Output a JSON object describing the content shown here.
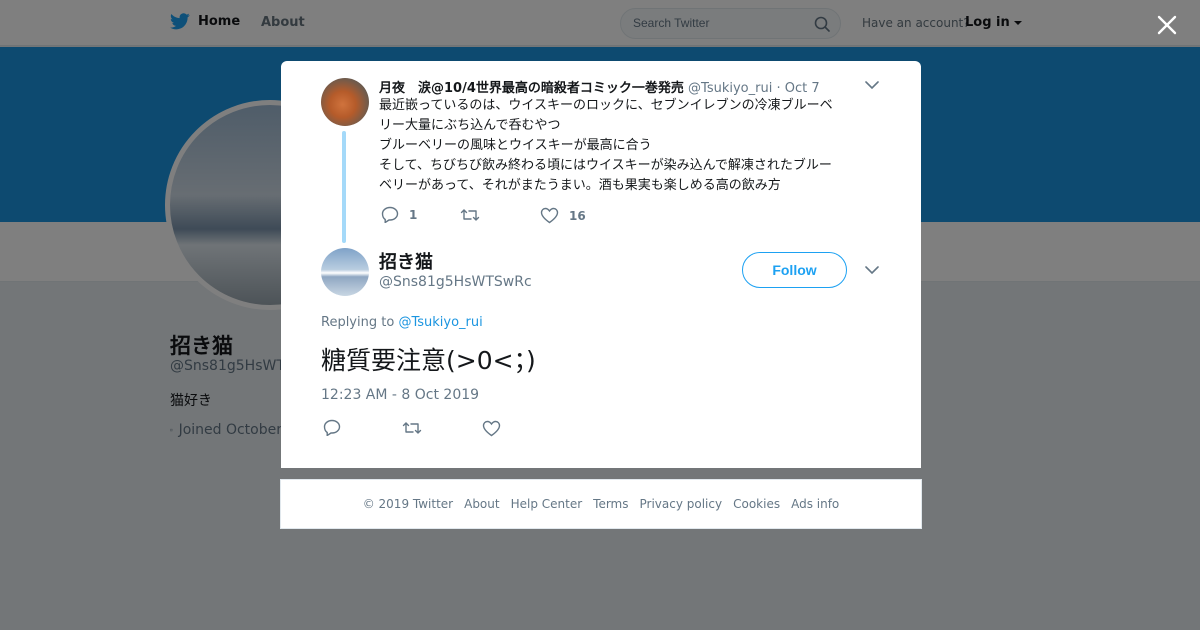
{
  "topbar": {
    "home_label": "Home",
    "about_label": "About",
    "search_placeholder": "Search Twitter",
    "have_account": "Have an account?",
    "login_label": "Log in"
  },
  "profile": {
    "name": "招き猫",
    "handle": "@Sns81g5HsWTSwRc",
    "bio": "猫好き",
    "joined": "Joined October"
  },
  "parent_tweet": {
    "name": "月夜　涙@10/4世界最高の暗殺者コミック一巻発売",
    "handle": "@Tsukiyo_rui",
    "separator": "·",
    "date": "Oct 7",
    "lines": [
      "最近嵌っているのは、ウイスキーのロックに、セブンイレブンの冷凍ブルーベ",
      "リー大量にぶち込んで呑むやつ",
      "ブルーベリーの風味とウイスキーが最高に合う",
      "そして、ちびちび飲み終わる頃にはウイスキーが染み込んで解凍されたブルー",
      "ベリーがあって、それがまたうまい。酒も果実も楽しめる高の飲み方"
    ],
    "reply_count": "1",
    "retweet_count": "",
    "like_count": "16"
  },
  "main_tweet": {
    "name": "招き猫",
    "handle": "@Sns81g5HsWTSwRc",
    "follow_label": "Follow",
    "replying_prefix": "Replying to",
    "replying_to": "@Tsukiyo_rui",
    "text": "糖質要注意(>0<；)",
    "timestamp": "12:23 AM - 8 Oct 2019"
  },
  "footer": {
    "links": [
      "© 2019 Twitter",
      "About",
      "Help Center",
      "Terms",
      "Privacy policy",
      "Cookies",
      "Ads info"
    ]
  },
  "colors": {
    "brand_blue": "#1da1f2",
    "link_blue": "#1b95e0",
    "banner_blue": "#1b95e0",
    "thread_line": "#a4d9f9",
    "muted_text": "#657786"
  },
  "icons": [
    "twitter-bird-icon",
    "search-icon",
    "caret-down-icon",
    "close-icon",
    "calendar-icon",
    "reply-icon",
    "retweet-icon",
    "like-icon",
    "chevron-down-icon"
  ]
}
